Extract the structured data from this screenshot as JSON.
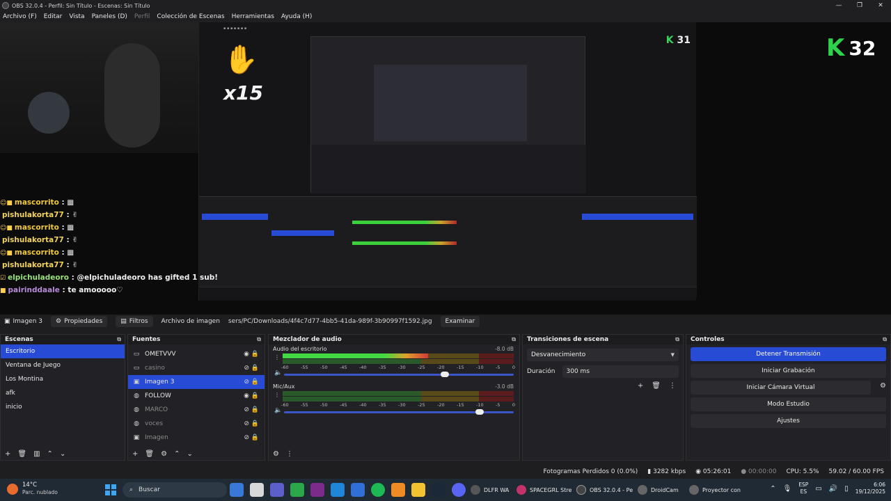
{
  "window": {
    "title": "OBS 32.0.4 - Perfil: Sin Título - Escenas: Sin Título",
    "controls": [
      "—",
      "❐",
      "✕"
    ]
  },
  "menu": [
    {
      "label": "Archivo (F)",
      "enabled": true
    },
    {
      "label": "Editar",
      "enabled": true
    },
    {
      "label": "Vista",
      "enabled": true
    },
    {
      "label": "Paneles (D)",
      "enabled": true
    },
    {
      "label": "Perfil",
      "enabled": false
    },
    {
      "label": "Colección de Escenas",
      "enabled": true
    },
    {
      "label": "Herramientas",
      "enabled": true
    },
    {
      "label": "Ayuda (H)",
      "enabled": true
    }
  ],
  "overlay": {
    "k_counter_main": "32",
    "k_counter_nested": "31",
    "combo_big": "x15",
    "combo_small": "x15",
    "chat": [
      {
        "emotes": "☺■",
        "user": "mascorrito",
        "sep": " :",
        "msg": " ▦"
      },
      {
        "emotes": "",
        "user": "pishulakorta77",
        "sep": " :",
        "msg": " ✌"
      },
      {
        "emotes": "☺■",
        "user": "mascorrito",
        "sep": " :",
        "msg": " ▦"
      },
      {
        "emotes": "",
        "user": "pishulakorta77",
        "sep": " :",
        "msg": " ✌"
      },
      {
        "emotes": "☺■",
        "user": "mascorrito",
        "sep": " :",
        "msg": " ▦"
      },
      {
        "emotes": "",
        "user": "pishulakorta77",
        "sep": " :",
        "msg": " ✌"
      },
      {
        "emotes": "☑",
        "user": "elpichuladeoro",
        "sep": " :",
        "msg": " @elpichuladeoro has gifted 1 sub!"
      },
      {
        "emotes": "■",
        "user": "pairinddaale",
        "sep": " :",
        "msg": " te amooooo♡"
      }
    ]
  },
  "context_bar": {
    "source_name": "Imagen 3",
    "properties": "Propiedades",
    "filters": "Filtros",
    "image_file_label": "Archivo de imagen",
    "image_path": "sers/PC/Downloads/4f4c7d77-4bb5-41da-989f-3b90997f1592.jpg",
    "browse": "Examinar"
  },
  "scenes": {
    "title": "Escenas",
    "items": [
      "Escritorio",
      "Ventana de Juego",
      "Los Montina",
      "afk",
      "inicio"
    ],
    "selected_index": 0
  },
  "sources": {
    "title": "Fuentes",
    "items": [
      {
        "name": "OMETVVV",
        "visible": true,
        "selected": false,
        "icon": "window-icon"
      },
      {
        "name": "casino",
        "visible": false,
        "selected": false,
        "icon": "window-icon"
      },
      {
        "name": "Imagen 3",
        "visible": false,
        "selected": true,
        "icon": "image-icon"
      },
      {
        "name": "FOLLOW",
        "visible": true,
        "selected": false,
        "icon": "browser-icon"
      },
      {
        "name": "MARCO",
        "visible": false,
        "selected": false,
        "icon": "browser-icon"
      },
      {
        "name": "voces",
        "visible": false,
        "selected": false,
        "icon": "browser-icon"
      },
      {
        "name": "Imagen",
        "visible": false,
        "selected": false,
        "icon": "image-icon"
      }
    ]
  },
  "mixer": {
    "title": "Mezclador de audio",
    "ticks": [
      "-60",
      "-55",
      "-50",
      "-45",
      "-40",
      "-35",
      "-30",
      "-25",
      "-20",
      "-15",
      "-10",
      "-5",
      "0"
    ],
    "channels": [
      {
        "name": "Audio del escritorio",
        "db": "-8.0 dB",
        "level": 0.63,
        "volume": 0.7
      },
      {
        "name": "Mic/Aux",
        "db": "-3.0 dB",
        "level": 0.0,
        "volume": 0.85
      }
    ]
  },
  "transitions": {
    "title": "Transiciones de escena",
    "selected": "Desvanecimiento",
    "duration_label": "Duración",
    "duration_value": "300 ms"
  },
  "controls": {
    "title": "Controles",
    "buttons": [
      {
        "label": "Detener Transmisión",
        "active": true
      },
      {
        "label": "Iniciar Grabación",
        "active": false
      },
      {
        "label": "Iniciar Cámara Virtual",
        "active": false
      },
      {
        "label": "Modo Estudio",
        "active": false
      },
      {
        "label": "Ajustes",
        "active": false
      }
    ]
  },
  "status": {
    "dropped": "Fotogramas Perdidos 0 (0.0%)",
    "bitrate": "3282 kbps",
    "stream_time": "05:26:01",
    "rec_time": "00:00:00",
    "cpu": "CPU: 5.5%",
    "fps": "59.02 / 60.00 FPS"
  },
  "taskbar": {
    "weather_temp": "14°C",
    "weather_desc": "Parc. nublado",
    "search_placeholder": "Buscar",
    "windows": [
      {
        "label": "DLFR WA",
        "color": "#555555"
      },
      {
        "label": "SPACEGRL Stre",
        "color": "#c2336b"
      },
      {
        "label": "OBS 32.0.4 - Pe",
        "color": "#444444"
      },
      {
        "label": "DroidCam",
        "color": "#666666"
      },
      {
        "label": "Proyector con",
        "color": "#666666"
      }
    ],
    "lang1": "ESP",
    "lang2": "ES",
    "time": "6:06",
    "date": "19/12/2025",
    "accent": "#284bd6"
  }
}
